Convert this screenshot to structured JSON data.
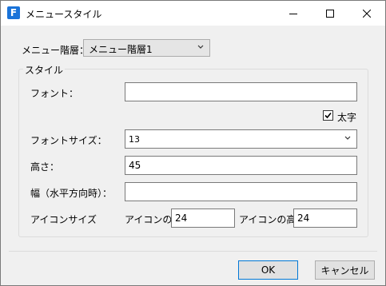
{
  "window": {
    "app_icon_letter": "F",
    "title": "メニュースタイル"
  },
  "menu_level": {
    "label": "メニュー階層：",
    "value": "メニュー階層1"
  },
  "style_group": {
    "legend": "スタイル",
    "font": {
      "label": "フォント：",
      "value": ""
    },
    "bold": {
      "label": "太字",
      "checked": true
    },
    "font_size": {
      "label": "フォントサイズ：",
      "value": "13"
    },
    "height": {
      "label": "高さ：",
      "value": "45"
    },
    "width": {
      "label": "幅（水平方向時）：",
      "value": ""
    },
    "icon_size": {
      "label": "アイコンサイズ",
      "icon_width_label": "アイコンの幅",
      "icon_width_value": "24",
      "icon_height_label": "アイコンの高さ",
      "icon_height_value": "24"
    }
  },
  "buttons": {
    "ok": "OK",
    "cancel": "キャンセル"
  },
  "colors": {
    "accent": "#0078d7",
    "app_icon": "#1a73d9"
  }
}
